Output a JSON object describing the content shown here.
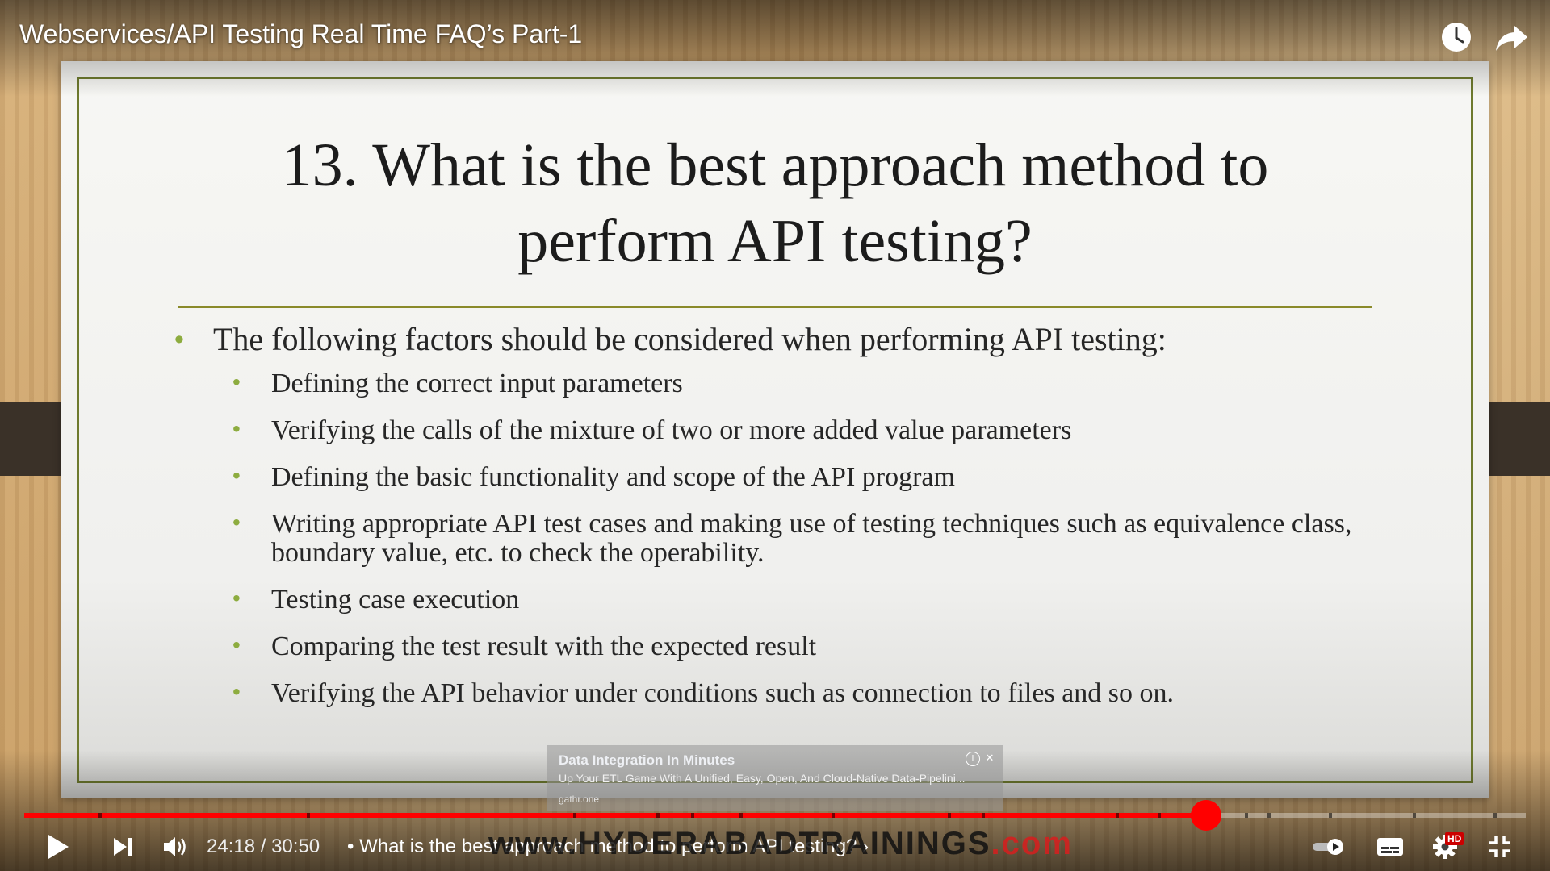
{
  "video": {
    "title": "Webservices/API Testing Real Time FAQ’s Part-1",
    "current_time": "24:18",
    "duration": "30:50",
    "time_separator": "/",
    "chapter_title": "• What is the best approach method to perform API testing?",
    "chapter_chevron": "›",
    "progress": 0.787,
    "watermark_text": "www.HYDERABADTRAININGS",
    "watermark_domain": ".com",
    "hd_badge": "HD"
  },
  "slide": {
    "title_line1": "13. What is the best approach method to",
    "title_line2": "perform API testing?",
    "bullet": "The following factors should be considered when performing API testing:",
    "sub_bullets": [
      "Defining the correct input parameters",
      "Verifying the calls of the mixture of two or more added value parameters",
      "Defining the basic functionality and scope of the API program",
      "Writing appropriate API test cases and making use of testing techniques such as equivalence class, boundary value, etc. to check the operability.",
      "Testing case execution",
      "Comparing the test result with the expected result",
      "Verifying the API behavior under conditions such as connection to files and so on."
    ],
    "bullet_color": "#8dac3f",
    "rule_color": "#8a8a2a",
    "frame_color": "#6e7a2e"
  },
  "ad": {
    "title": "Data Integration In Minutes",
    "description": "Up Your ETL Game With A Unified, Easy, Open, And Cloud-Native Data-Pipelini...",
    "domain": "gathr.one",
    "info_glyph": "i",
    "close_glyph": "✕"
  },
  "icons": [
    "watch-later-icon",
    "share-icon",
    "play-icon",
    "next-icon",
    "volume-icon",
    "autoplay-toggle-icon",
    "subtitles-icon",
    "settings-icon",
    "exit-fullscreen-icon"
  ],
  "colors": {
    "progress": "#ff0000",
    "accent": "#ff0000"
  }
}
